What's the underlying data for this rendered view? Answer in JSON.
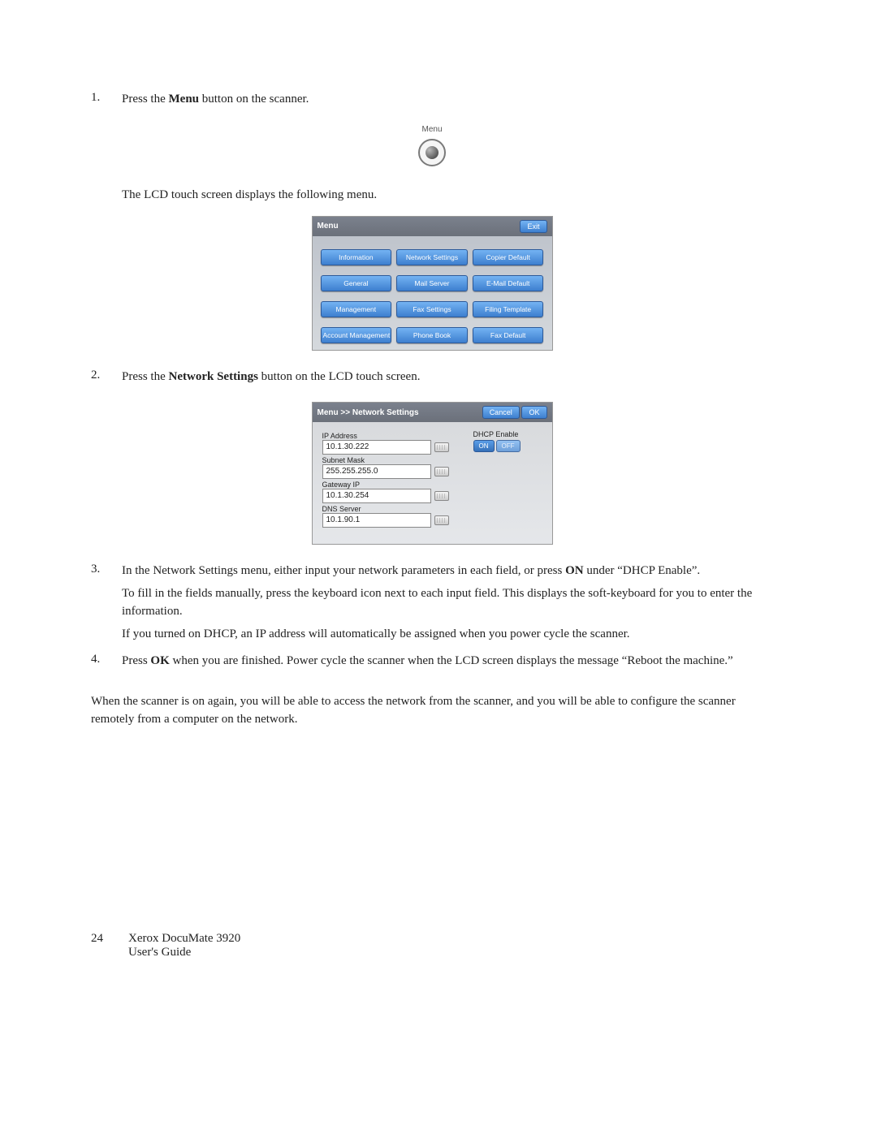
{
  "steps": {
    "s1": {
      "num": "1.",
      "text_a": "Press the ",
      "bold": "Menu",
      "text_b": " button on the scanner."
    },
    "s1_caption": "Menu",
    "s1_after": "The LCD touch screen displays the following menu.",
    "s2": {
      "num": "2.",
      "text_a": "Press the ",
      "bold": "Network Settings",
      "text_b": " button on the LCD touch screen."
    },
    "s3": {
      "num": "3.",
      "p1_a": "In the Network Settings menu, either input your network parameters in each field, or press ",
      "p1_bold": "ON",
      "p1_b": " under “DHCP Enable”.",
      "p2": "To fill in the fields manually, press the keyboard icon next to each input field. This displays the soft-keyboard for you to enter the information.",
      "p3": "If you turned on DHCP, an IP address will automatically be assigned when you power cycle the scanner."
    },
    "s4": {
      "num": "4.",
      "p_a": "Press ",
      "p_bold": "OK",
      "p_b": " when you are finished. Power cycle the scanner when the LCD screen displays the message “Reboot the machine.”"
    }
  },
  "closing": "When the scanner is on again, you will be able to access the network from the scanner, and you will be able to configure the scanner remotely from a computer on the network.",
  "lcd1": {
    "title": "Menu",
    "exit": "Exit",
    "buttons": [
      "Information",
      "Network Settings",
      "Copier Default",
      "General",
      "Mail Server",
      "E-Mail Default",
      "Management",
      "Fax Settings",
      "Filing Template",
      "Account Management",
      "Phone Book",
      "Fax Default"
    ]
  },
  "lcd2": {
    "title": "Menu >> Network Settings",
    "cancel": "Cancel",
    "ok": "OK",
    "dhcp_label": "DHCP Enable",
    "toggle_on": "ON",
    "toggle_off": "OFF",
    "fields": {
      "ip_label": "IP Address",
      "ip_value": "10.1.30.222",
      "subnet_label": "Subnet Mask",
      "subnet_value": "255.255.255.0",
      "gateway_label": "Gateway IP",
      "gateway_value": "10.1.30.254",
      "dns_label": "DNS Server",
      "dns_value": "10.1.90.1"
    }
  },
  "footer": {
    "page": "24",
    "line1": "Xerox DocuMate 3920",
    "line2": "User's Guide"
  }
}
